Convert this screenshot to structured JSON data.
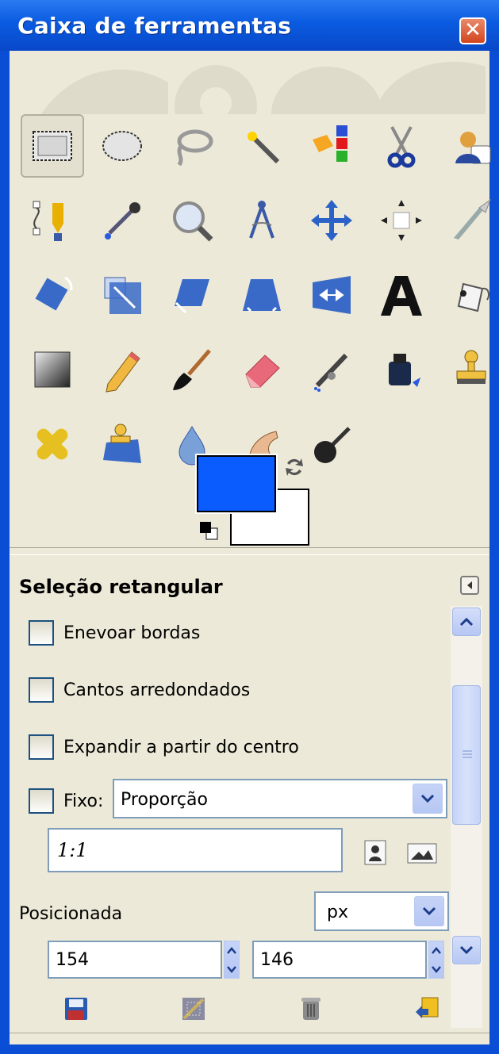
{
  "window": {
    "title": "Caixa de ferramentas",
    "close_icon": "close-icon"
  },
  "toolbox": {
    "tools": [
      {
        "name": "rect-select-tool",
        "icon": "rect-select-icon",
        "active": true
      },
      {
        "name": "ellipse-select-tool",
        "icon": "ellipse-select-icon"
      },
      {
        "name": "free-select-tool",
        "icon": "lasso-icon"
      },
      {
        "name": "fuzzy-select-tool",
        "icon": "magic-wand-icon"
      },
      {
        "name": "select-by-color-tool",
        "icon": "select-by-color-icon"
      },
      {
        "name": "scissors-select-tool",
        "icon": "scissors-icon"
      },
      {
        "name": "foreground-select-tool",
        "icon": "foreground-select-icon"
      },
      {
        "name": "paths-tool",
        "icon": "paths-pen-icon"
      },
      {
        "name": "color-picker-tool",
        "icon": "eyedropper-icon"
      },
      {
        "name": "zoom-tool",
        "icon": "magnifier-icon"
      },
      {
        "name": "measure-tool",
        "icon": "compass-icon"
      },
      {
        "name": "move-tool",
        "icon": "move-arrows-icon"
      },
      {
        "name": "align-tool",
        "icon": "align-icon"
      },
      {
        "name": "crop-tool",
        "icon": "crop-knife-icon"
      },
      {
        "name": "rotate-tool",
        "icon": "rotate-icon"
      },
      {
        "name": "scale-tool",
        "icon": "scale-icon"
      },
      {
        "name": "shear-tool",
        "icon": "shear-icon"
      },
      {
        "name": "perspective-tool",
        "icon": "perspective-icon"
      },
      {
        "name": "flip-tool",
        "icon": "flip-icon"
      },
      {
        "name": "text-tool",
        "icon": "text-a-icon"
      },
      {
        "name": "bucket-fill-tool",
        "icon": "bucket-icon"
      },
      {
        "name": "blend-tool",
        "icon": "gradient-icon"
      },
      {
        "name": "pencil-tool",
        "icon": "pencil-icon"
      },
      {
        "name": "paintbrush-tool",
        "icon": "brush-icon"
      },
      {
        "name": "eraser-tool",
        "icon": "eraser-icon"
      },
      {
        "name": "airbrush-tool",
        "icon": "airbrush-icon"
      },
      {
        "name": "ink-tool",
        "icon": "ink-icon"
      },
      {
        "name": "clone-tool",
        "icon": "clone-stamp-icon"
      },
      {
        "name": "heal-tool",
        "icon": "bandage-icon"
      },
      {
        "name": "perspective-clone-tool",
        "icon": "perspective-clone-icon"
      },
      {
        "name": "blur-sharpen-tool",
        "icon": "water-drop-icon"
      },
      {
        "name": "smudge-tool",
        "icon": "smudge-finger-icon"
      },
      {
        "name": "dodge-burn-tool",
        "icon": "dodge-burn-icon"
      }
    ],
    "foreground_color": "#0a5cff",
    "background_color": "#ffffff"
  },
  "options": {
    "title": "Seleção retangular",
    "feather_label": "Enevoar bordas",
    "rounded_label": "Cantos arredondados",
    "expand_label": "Expandir a partir do centro",
    "fixed_label": "Fixo:",
    "fixed_mode": "Proporção",
    "ratio_value": "1:1",
    "position_label": "Posicionada",
    "unit": "px",
    "pos_x": "154",
    "pos_y": "146"
  },
  "bottom_buttons": [
    "save-options-icon",
    "restore-options-icon",
    "delete-options-icon",
    "reset-options-icon"
  ]
}
